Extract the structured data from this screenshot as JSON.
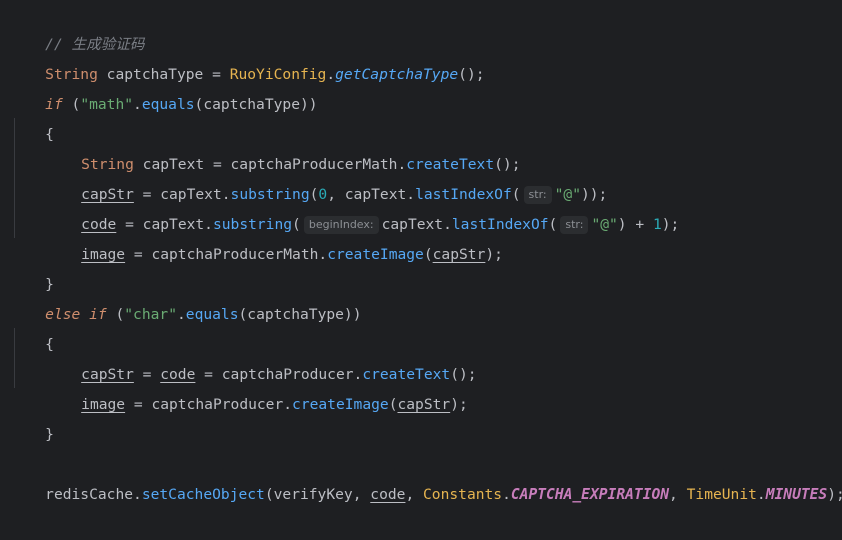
{
  "code": {
    "comment": "// 生成验证码",
    "l1": {
      "type": "String",
      "var": "captchaType",
      "eq": " = ",
      "cls": "RuoYiConfig",
      "dot": ".",
      "method": "getCaptchaType",
      "tail": "();"
    },
    "l2": {
      "kw": "if",
      "open": " (",
      "lit": "\"math\"",
      "dot": ".",
      "method": "equals",
      "arg": "(captchaType)",
      "close": ")"
    },
    "l3": {
      "brace": "{"
    },
    "l4": {
      "type": "String",
      "rest": " capText = captchaProducerMath.",
      "method": "createText",
      "tail": "();"
    },
    "l5": {
      "var": "capStr",
      "a": " = capText.",
      "m1": "substring",
      "b": "(",
      "n0": "0",
      "c": ", capText.",
      "m2": "lastIndexOf",
      "d": "(",
      "hint": "str:",
      "lit": "\"@\"",
      "e": "));"
    },
    "l6": {
      "var": "code",
      "a": " = capText.",
      "m1": "substring",
      "b": "(",
      "hint1": "beginIndex:",
      "c": "capText.",
      "m2": "lastIndexOf",
      "d": "(",
      "hint2": "str:",
      "lit": "\"@\"",
      "e": ") + ",
      "n1": "1",
      "f": ");"
    },
    "l7": {
      "var": "image",
      "a": " = captchaProducerMath.",
      "method": "createImage",
      "b": "(",
      "arg": "capStr",
      "c": ");"
    },
    "l8": {
      "brace": "}"
    },
    "l9": {
      "kw1": "else",
      "kw2": "if",
      "open": " (",
      "lit": "\"char\"",
      "dot": ".",
      "method": "equals",
      "arg": "(captchaType)",
      "close": ")"
    },
    "l10": {
      "brace": "{"
    },
    "l11": {
      "var1": "capStr",
      "a": " = ",
      "var2": "code",
      "b": " = captchaProducer.",
      "method": "createText",
      "c": "();"
    },
    "l12": {
      "var": "image",
      "a": " = captchaProducer.",
      "method": "createImage",
      "b": "(",
      "arg": "capStr",
      "c": ");"
    },
    "l13": {
      "brace": "}"
    },
    "l15": {
      "obj": "redisCache",
      "dot": ".",
      "method": "setCacheObject",
      "a": "(verifyKey, ",
      "var": "code",
      "b": ", ",
      "cls1": "Constants",
      "dot2": ".",
      "const1": "CAPTCHA_EXPIRATION",
      "c": ", ",
      "cls2": "TimeUnit",
      "dot3": ".",
      "const2": "MINUTES",
      "d": ");"
    }
  }
}
